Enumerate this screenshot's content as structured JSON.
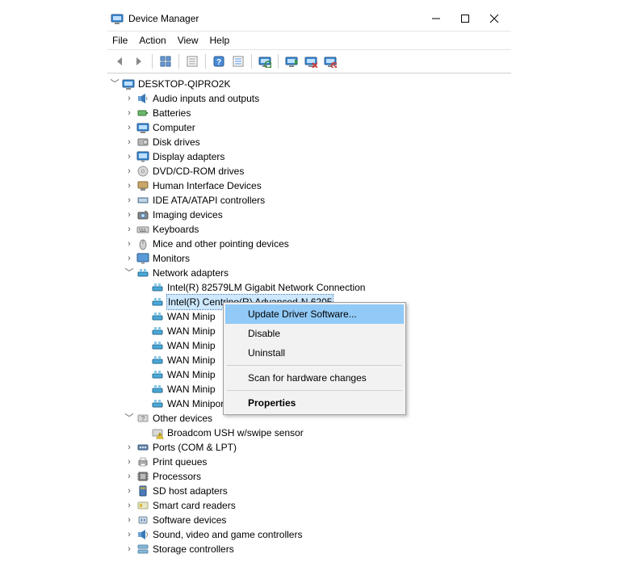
{
  "window": {
    "title": "Device Manager"
  },
  "menubar": [
    "File",
    "Action",
    "View",
    "Help"
  ],
  "root": {
    "label": "DESKTOP-QIPRO2K",
    "expanded": true
  },
  "categories": [
    {
      "label": "Audio inputs and outputs",
      "icon": "audio-icon",
      "expanded": false,
      "children": []
    },
    {
      "label": "Batteries",
      "icon": "battery-icon",
      "expanded": false,
      "children": []
    },
    {
      "label": "Computer",
      "icon": "computer-icon",
      "expanded": false,
      "children": []
    },
    {
      "label": "Disk drives",
      "icon": "disk-icon",
      "expanded": false,
      "children": []
    },
    {
      "label": "Display adapters",
      "icon": "display-icon",
      "expanded": false,
      "children": []
    },
    {
      "label": "DVD/CD-ROM drives",
      "icon": "dvd-icon",
      "expanded": false,
      "children": []
    },
    {
      "label": "Human Interface Devices",
      "icon": "hid-icon",
      "expanded": false,
      "children": []
    },
    {
      "label": "IDE ATA/ATAPI controllers",
      "icon": "ide-icon",
      "expanded": false,
      "children": []
    },
    {
      "label": "Imaging devices",
      "icon": "imaging-icon",
      "expanded": false,
      "children": []
    },
    {
      "label": "Keyboards",
      "icon": "keyboard-icon",
      "expanded": false,
      "children": []
    },
    {
      "label": "Mice and other pointing devices",
      "icon": "mouse-icon",
      "expanded": false,
      "children": []
    },
    {
      "label": "Monitors",
      "icon": "monitor-icon",
      "expanded": false,
      "children": []
    },
    {
      "label": "Network adapters",
      "icon": "network-icon",
      "expanded": true,
      "children": [
        {
          "label": "Intel(R) 82579LM Gigabit Network Connection",
          "icon": "network-icon",
          "selected": false
        },
        {
          "label": "Intel(R) Centrino(R) Advanced-N 6205",
          "icon": "network-icon",
          "selected": true
        },
        {
          "label": "WAN Minip",
          "icon": "network-icon",
          "selected": false
        },
        {
          "label": "WAN Minip",
          "icon": "network-icon",
          "selected": false
        },
        {
          "label": "WAN Minip",
          "icon": "network-icon",
          "selected": false
        },
        {
          "label": "WAN Minip",
          "icon": "network-icon",
          "selected": false
        },
        {
          "label": "WAN Minip",
          "icon": "network-icon",
          "selected": false
        },
        {
          "label": "WAN Minip",
          "icon": "network-icon",
          "selected": false
        },
        {
          "label": "WAN Miniport (SSTP)",
          "icon": "network-icon",
          "selected": false
        }
      ]
    },
    {
      "label": "Other devices",
      "icon": "other-icon",
      "expanded": true,
      "children": [
        {
          "label": "Broadcom USH w/swipe sensor",
          "icon": "warning-icon",
          "selected": false
        }
      ]
    },
    {
      "label": "Ports (COM & LPT)",
      "icon": "port-icon",
      "expanded": false,
      "children": []
    },
    {
      "label": "Print queues",
      "icon": "printer-icon",
      "expanded": false,
      "children": []
    },
    {
      "label": "Processors",
      "icon": "cpu-icon",
      "expanded": false,
      "children": []
    },
    {
      "label": "SD host adapters",
      "icon": "sd-icon",
      "expanded": false,
      "children": []
    },
    {
      "label": "Smart card readers",
      "icon": "smartcard-icon",
      "expanded": false,
      "children": []
    },
    {
      "label": "Software devices",
      "icon": "software-icon",
      "expanded": false,
      "children": []
    },
    {
      "label": "Sound, video and game controllers",
      "icon": "sound-icon",
      "expanded": false,
      "children": []
    },
    {
      "label": "Storage controllers",
      "icon": "storage-icon",
      "expanded": false,
      "children": []
    }
  ],
  "context_menu": {
    "items": [
      {
        "label": "Update Driver Software...",
        "highlighted": true
      },
      {
        "label": "Disable"
      },
      {
        "label": "Uninstall"
      },
      {
        "sep": true
      },
      {
        "label": "Scan for hardware changes"
      },
      {
        "sep": true
      },
      {
        "label": "Properties",
        "bold": true
      }
    ]
  }
}
